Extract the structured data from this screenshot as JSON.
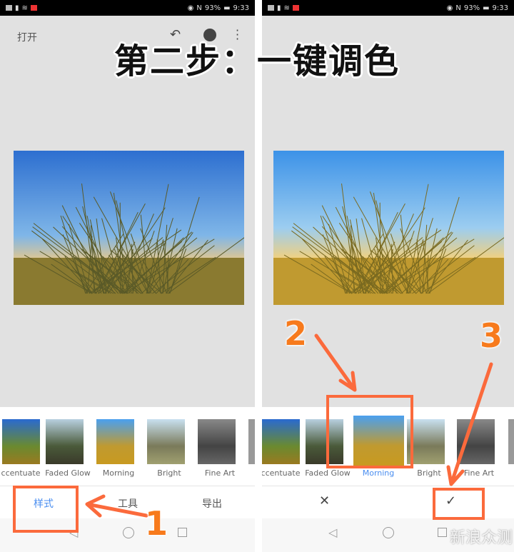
{
  "title": "第二步：一键调色",
  "status": {
    "battery": "93%",
    "time": "9:33"
  },
  "left": {
    "open_label": "打开",
    "thumbs": [
      "ccentuate",
      "Faded Glow",
      "Morning",
      "Bright",
      "Fine Art"
    ],
    "tabs": [
      "样式",
      "工具",
      "导出"
    ]
  },
  "right": {
    "thumbs": [
      "ccentuate",
      "Faded Glow",
      "Morning",
      "Bright",
      "Fine Art"
    ],
    "selected": "Morning",
    "cancel": "✕",
    "confirm": "✓"
  },
  "annotations": {
    "n1": "1",
    "n2": "2",
    "n3": "3"
  },
  "watermark": "新浪众测",
  "colors": {
    "accent": "#4a8ef0",
    "annotation": "#fb6a3c",
    "number": "#f77a1c"
  }
}
